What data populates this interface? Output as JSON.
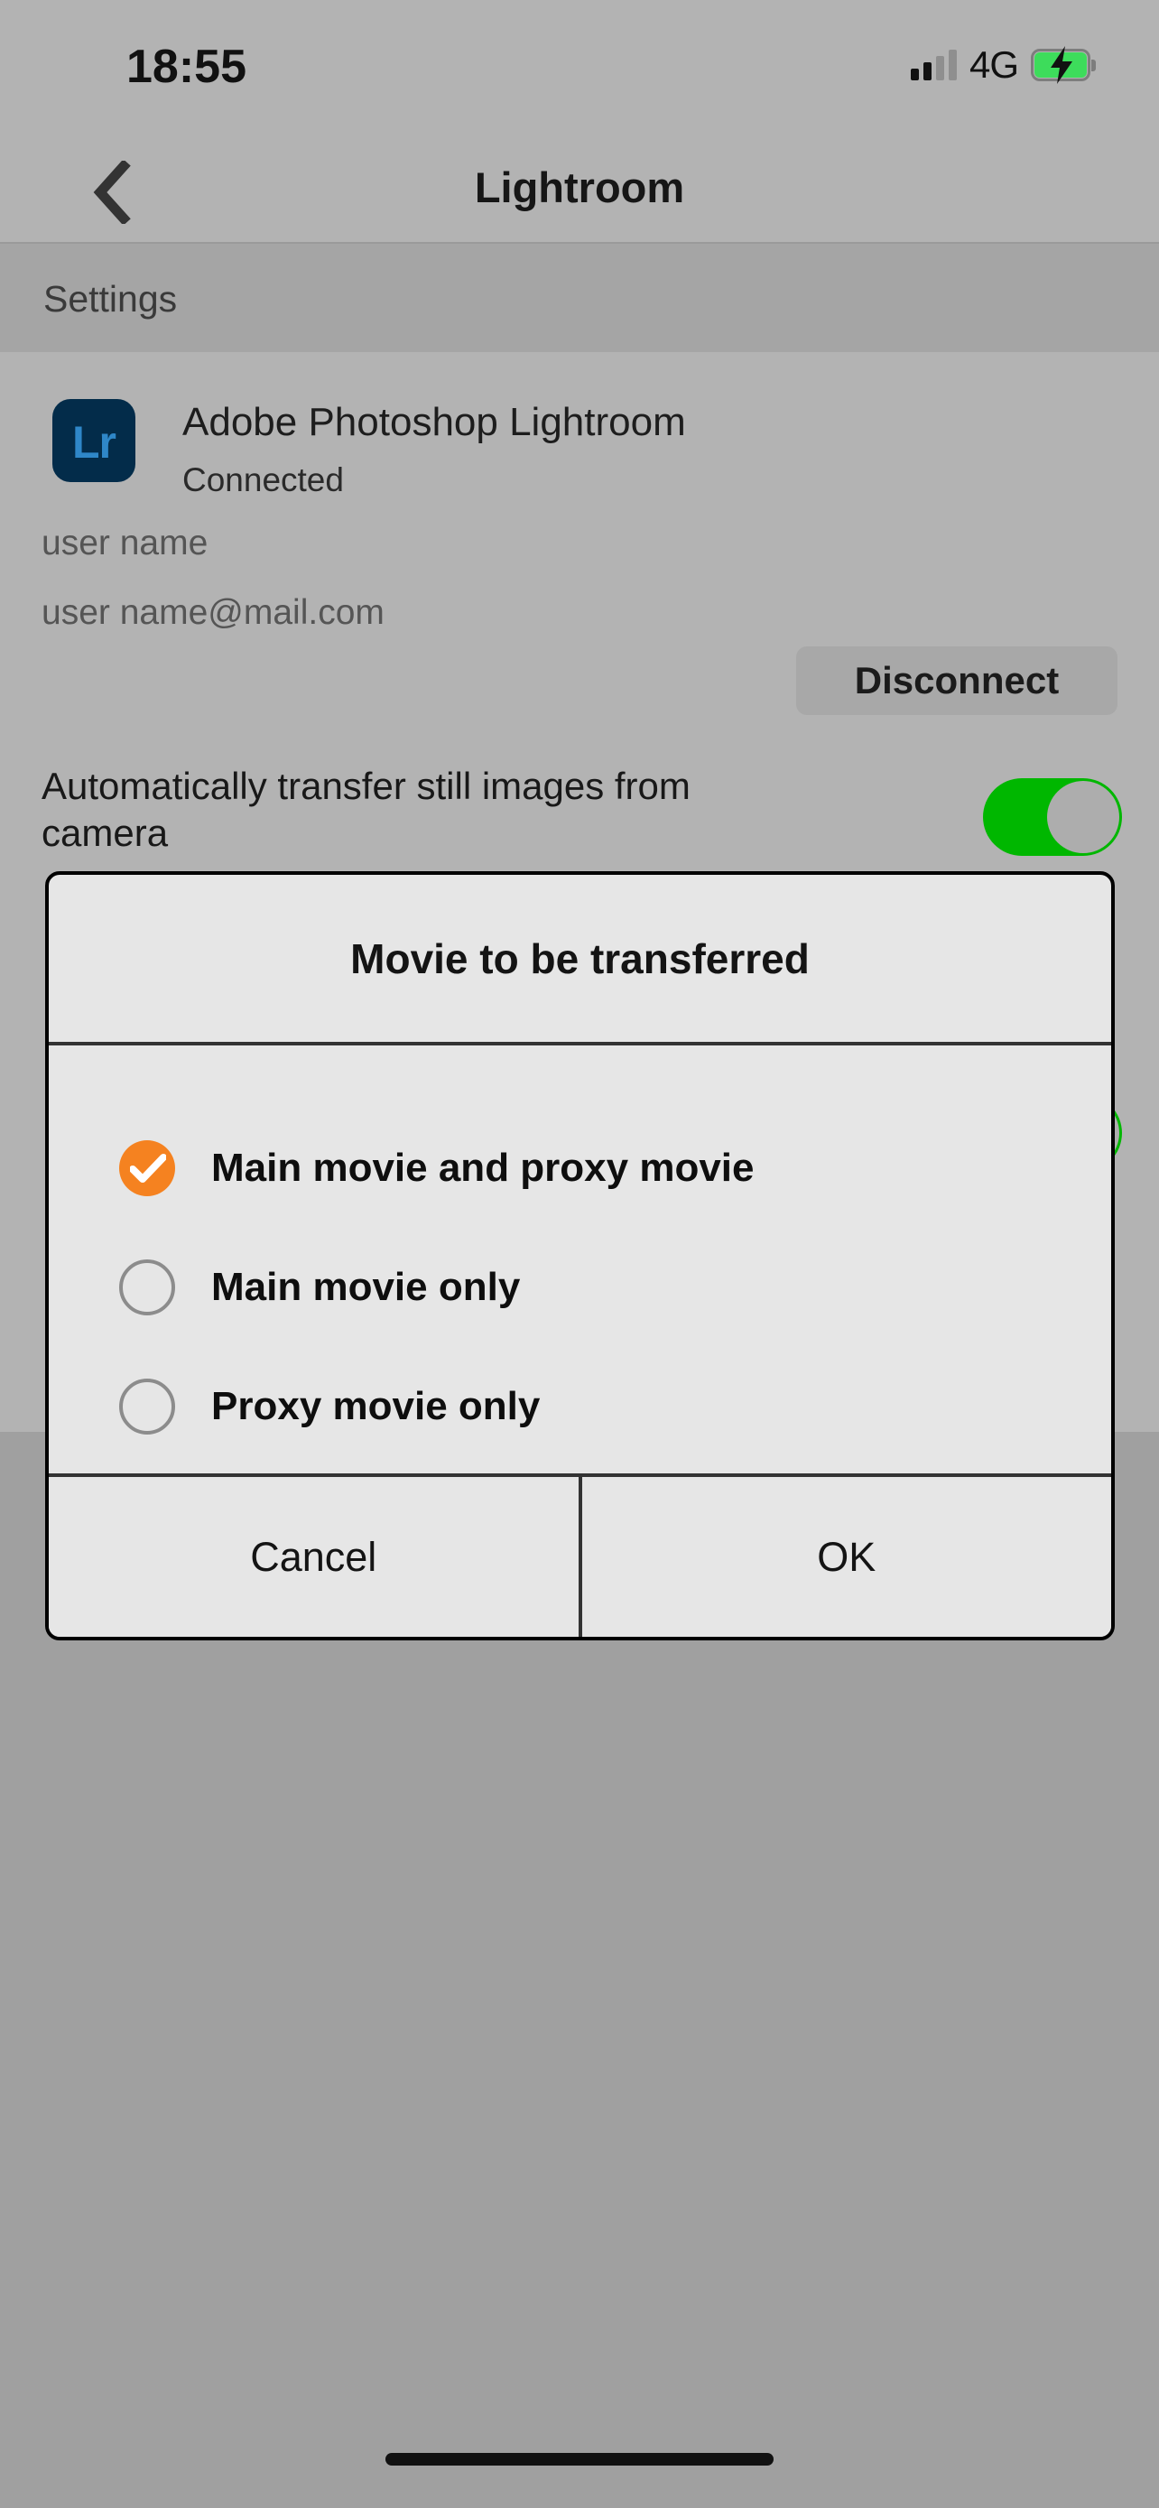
{
  "status_bar": {
    "time": "18:55",
    "network_label": "4G",
    "signal_bars_total": 4,
    "signal_bars_filled": 2,
    "battery_charging": true,
    "battery_color": "#3ddc5b"
  },
  "nav_bar": {
    "title": "Lightroom",
    "back_icon": "chevron-left-icon"
  },
  "section_header": {
    "label": "Settings"
  },
  "account": {
    "app_icon_text": "Lr",
    "app_icon_bg": "#032c4a",
    "app_icon_fg": "#2f87c8",
    "app_name": "Adobe Photoshop Lightroom",
    "connection_status": "Connected",
    "user_name": "user name",
    "user_email": "user name@mail.com",
    "disconnect_label": "Disconnect"
  },
  "auto_transfer": {
    "label": "Automatically transfer still images from camera",
    "toggle_on": true,
    "toggle_on_color": "#00b700"
  },
  "dialog": {
    "title": "Movie to be transferred",
    "selected_index": 0,
    "accent_color": "#f58220",
    "options": [
      {
        "label": "Main movie and proxy movie",
        "selected": true
      },
      {
        "label": "Main movie only",
        "selected": false
      },
      {
        "label": "Proxy movie only",
        "selected": false
      }
    ],
    "cancel_label": "Cancel",
    "ok_label": "OK"
  }
}
